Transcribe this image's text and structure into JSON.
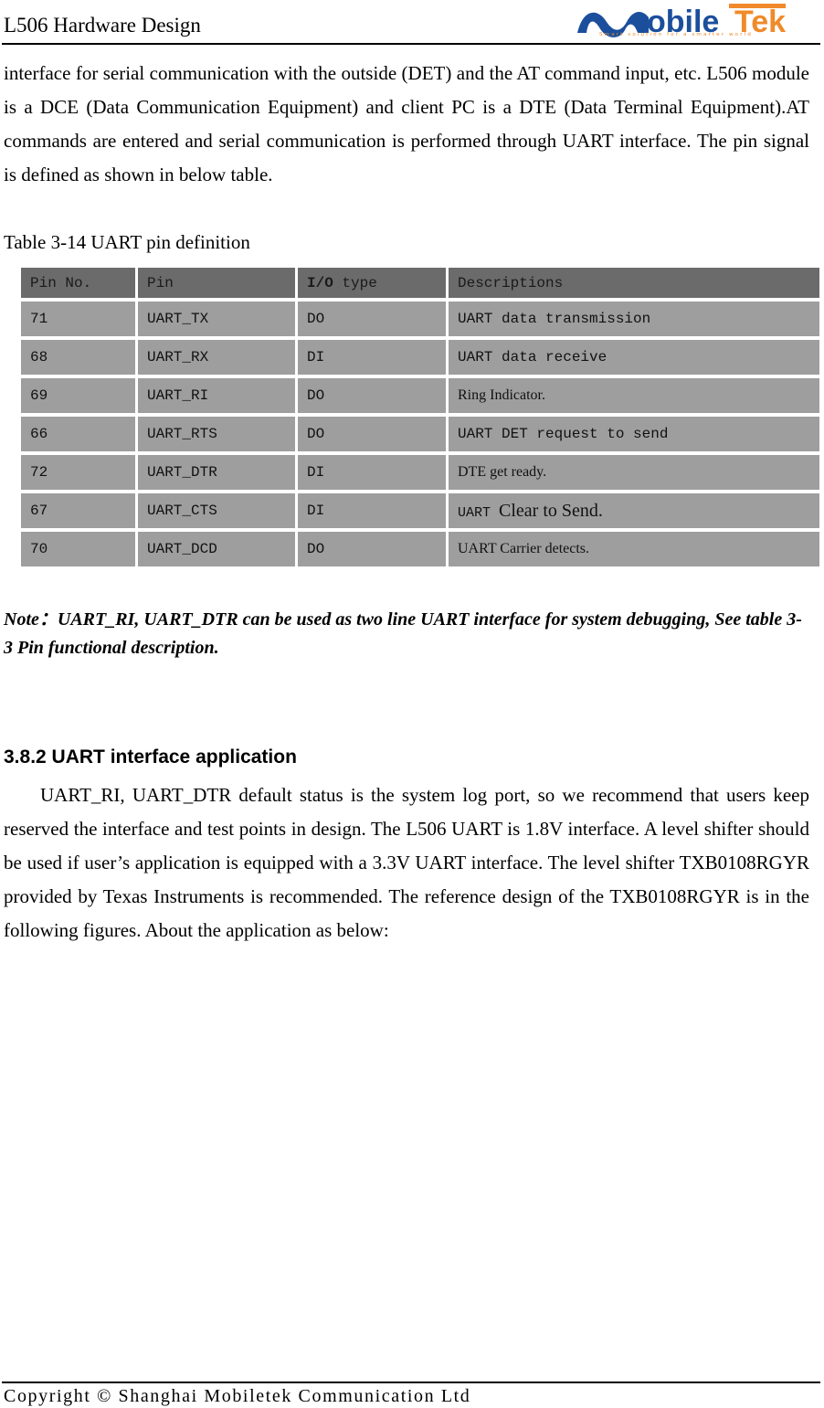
{
  "header": {
    "title": "L506 Hardware Design",
    "logo": {
      "name_blue": "obile",
      "name_orange": "Tek",
      "tagline": "Smart solution for a smarter world",
      "color_blue": "#1b4f9c",
      "color_orange": "#f08a2a"
    }
  },
  "intro_paragraph": "interface for serial communication with the outside (DET) and the AT command input, etc. L506 module is a DCE (Data Communication Equipment) and client PC is a DTE (Data Terminal Equipment).AT commands are entered and serial communication is performed through UART interface. The pin signal is defined as shown in below table.",
  "table": {
    "caption": "Table 3-14 UART pin definition",
    "header_bg": "#6b6b6b",
    "row_bg": "#9e9e9e",
    "columns": [
      {
        "label": "Pin No."
      },
      {
        "label": "Pin"
      },
      {
        "label_bold": "I/O",
        "label_rest": " type"
      },
      {
        "label": "Descriptions"
      }
    ],
    "rows": [
      {
        "pin_no": "71",
        "pin": "UART_TX",
        "io": "DO",
        "desc": "UART data transmission",
        "desc_style": "mono"
      },
      {
        "pin_no": "68",
        "pin": "UART_RX",
        "io": "DI",
        "desc": "UART data receive",
        "desc_style": "mono"
      },
      {
        "pin_no": "69",
        "pin": "UART_RI",
        "io": "DO",
        "desc": "Ring Indicator.",
        "desc_style": "serif"
      },
      {
        "pin_no": "66",
        "pin": "UART_RTS",
        "io": "DO",
        "desc": "UART DET request to send",
        "desc_style": "mono"
      },
      {
        "pin_no": "72",
        "pin": "UART_DTR",
        "io": "DI",
        "desc": "DTE get ready.",
        "desc_style": "serif"
      },
      {
        "pin_no": "67",
        "pin": "UART_CTS",
        "io": "DI",
        "desc_mono": "UART ",
        "desc_serif": "Clear to Send.",
        "desc_style": "mixed"
      },
      {
        "pin_no": "70",
        "pin": "UART_DCD",
        "io": "DO",
        "desc": "UART Carrier detects.",
        "desc_style": "serif"
      }
    ]
  },
  "note": "Note：UART_RI, UART_DTR can be used as two line UART interface for system debugging, See table 3-3 Pin functional description.",
  "section": {
    "heading": "3.8.2 UART interface application",
    "paragraph": "UART_RI, UART_DTR default status is the system log port, so we recommend that users keep reserved the interface and test points in design. The L506 UART is 1.8V interface. A level shifter should be used if user’s application is equipped with a 3.3V UART interface. The level shifter TXB0108RGYR provided by Texas Instruments is recommended. The reference design of the TXB0108RGYR is in the following figures. About the application as below:"
  },
  "footer": {
    "text": "Copyright © Shanghai Mobiletek Communication Ltd"
  }
}
